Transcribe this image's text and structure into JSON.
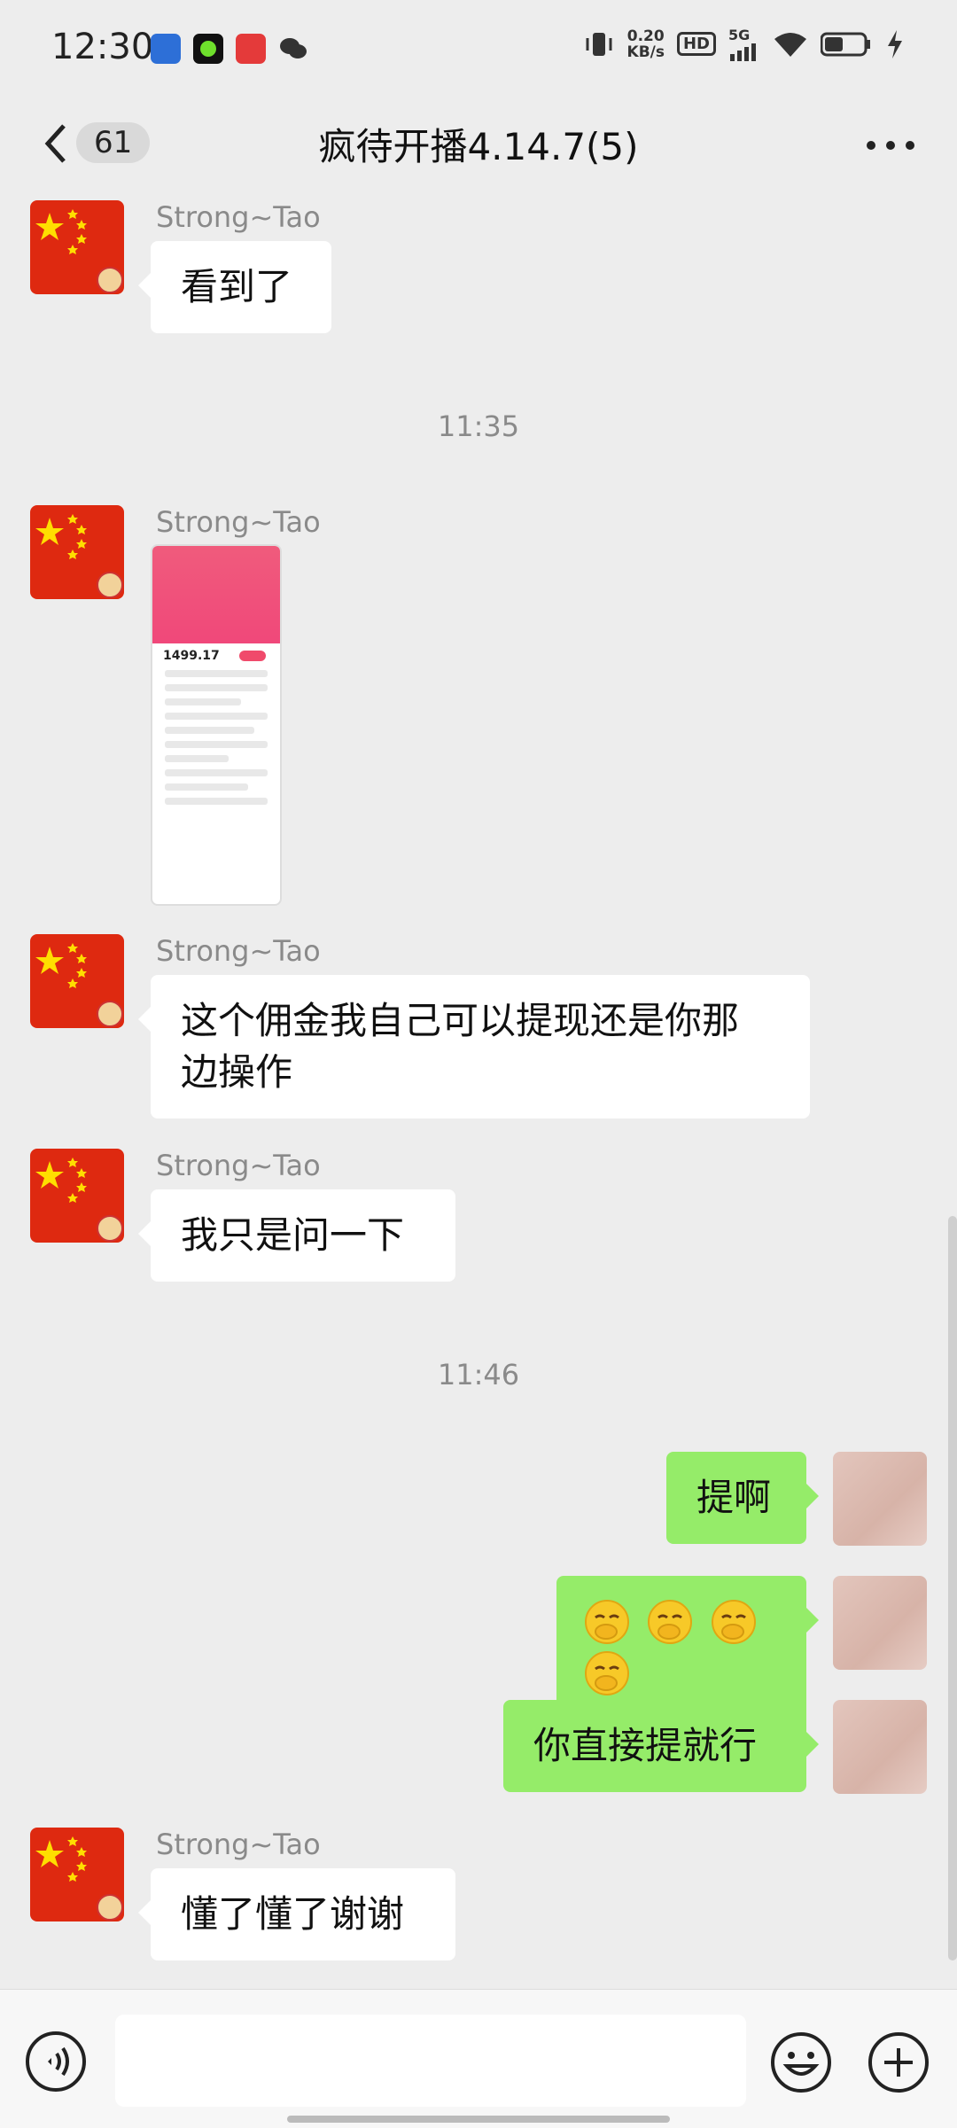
{
  "status_bar": {
    "time": "12:30",
    "net_speed_value": "0.20",
    "net_speed_unit": "KB/s",
    "hd": "HD",
    "network": "5G"
  },
  "header": {
    "unread_count": "61",
    "title": "疯待开播4.14.7(5)"
  },
  "messages": [
    {
      "sender": "Strong~Tao",
      "text": "看到了"
    },
    {
      "timestamp": "11:35"
    },
    {
      "sender": "Strong~Tao",
      "image": {
        "amount": "1499.17"
      }
    },
    {
      "sender": "Strong~Tao",
      "text_line1": "这个佣金我自己可以提现还是你那",
      "text_line2": "边操作"
    },
    {
      "sender": "Strong~Tao",
      "text": "我只是问一下"
    },
    {
      "timestamp": "11:46"
    },
    {
      "self": true,
      "text": "提啊"
    },
    {
      "self": true,
      "emoji": "face-with-hand-over-mouth x4"
    },
    {
      "self": true,
      "text": "你直接提就行"
    },
    {
      "sender": "Strong~Tao",
      "text": "懂了懂了谢谢"
    }
  ],
  "colors": {
    "background": "#ededed",
    "self_bubble": "#95ec69",
    "other_bubble": "#ffffff",
    "flag_red": "#de2910",
    "flag_star": "#ffde00"
  },
  "icons": [
    "back-arrow-icon",
    "more-icon",
    "voice-icon",
    "emoji-icon",
    "plus-icon"
  ]
}
